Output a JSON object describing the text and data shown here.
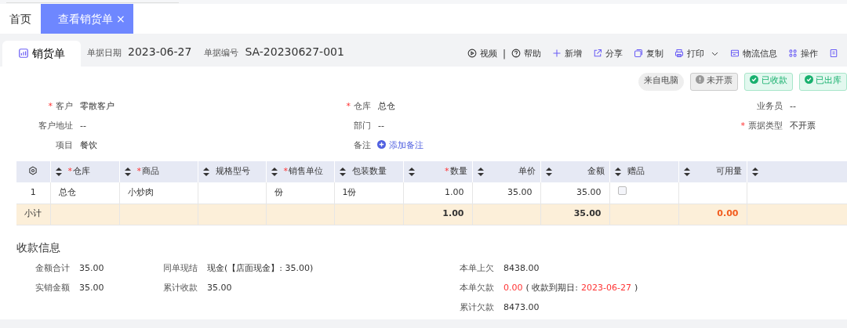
{
  "tabs": [
    {
      "label": "首页",
      "selected": false,
      "closable": false
    },
    {
      "label": "查看销货单",
      "selected": true,
      "closable": true
    }
  ],
  "close_glyph": "×",
  "doc_tab": {
    "label": "销货单",
    "selected": true
  },
  "header_fields": [
    {
      "label": "单据日期",
      "value": "2023-06-27"
    },
    {
      "label": "单据编号",
      "value": "SA-20230627-001"
    }
  ],
  "toolbar": [
    {
      "label": "视频",
      "has_menu": false
    },
    {
      "label": "帮助",
      "has_menu": false
    },
    {
      "label": "新增",
      "has_menu": false
    },
    {
      "label": "分享",
      "has_menu": false
    },
    {
      "label": "复制",
      "has_menu": false
    },
    {
      "label": "打印",
      "has_menu": true
    },
    {
      "label": "物流信息",
      "has_menu": false
    },
    {
      "label": "操作",
      "has_menu": false
    },
    {
      "has_menu": false
    }
  ],
  "toolbar_separator": "|",
  "status_tags": [
    {
      "label": "来自电脑",
      "kind": "source"
    },
    {
      "label": "未开票",
      "kind": "warning"
    },
    {
      "label": "已收款",
      "kind": "done"
    },
    {
      "label": "已出库",
      "kind": "done"
    }
  ],
  "form_rows": [
    [
      {
        "label": "客户",
        "value": "零散客户",
        "required": true,
        "kind": "text"
      },
      {
        "label": "仓库",
        "value": "总仓",
        "required": true,
        "kind": "text"
      },
      {
        "label": "业务员",
        "value": "--",
        "required": false,
        "kind": "text"
      }
    ],
    [
      {
        "label": "客户地址",
        "value": "--",
        "required": false,
        "kind": "text"
      },
      {
        "label": "部门",
        "value": "--",
        "required": false,
        "kind": "text"
      },
      {
        "label": "票据类型",
        "value": "不开票",
        "required": true,
        "kind": "text"
      }
    ],
    [
      {
        "label": "项目",
        "value": "餐饮",
        "required": false,
        "kind": "text"
      },
      {
        "label": "备注",
        "value": "添加备注",
        "required": false,
        "kind": "link"
      }
    ]
  ],
  "required_mark": "*",
  "table": {
    "columns": [
      {
        "kind": "settings"
      },
      {
        "label": "仓库",
        "kind": "text",
        "sortable": true,
        "required": true
      },
      {
        "label": "商品",
        "kind": "text",
        "sortable": true,
        "required": true
      },
      {
        "label": "规格型号",
        "kind": "text",
        "sortable": true,
        "required": false
      },
      {
        "label": "销售单位",
        "kind": "text",
        "sortable": true,
        "required": true
      },
      {
        "label": "包装数量",
        "kind": "text",
        "sortable": true,
        "required": false
      },
      {
        "label": "数量",
        "kind": "number",
        "sortable": true,
        "required": true
      },
      {
        "label": "单价",
        "kind": "number",
        "sortable": true,
        "required": false
      },
      {
        "label": "金额",
        "kind": "number",
        "sortable": true,
        "required": false
      },
      {
        "label": "赠品",
        "kind": "check",
        "sortable": true,
        "required": false
      },
      {
        "label": "可用量",
        "kind": "number",
        "sortable": true,
        "required": false
      },
      {
        "kind": "text",
        "sortable": true,
        "required": false
      }
    ],
    "rows": [
      {
        "cells": [
          "1",
          "总仓",
          "小炒肉",
          "",
          "份",
          "1份",
          "1.00",
          "35.00",
          "35.00",
          false,
          "",
          ""
        ]
      }
    ],
    "subtotal": {
      "cells": [
        {
          "text": "小计",
          "highlight": false
        },
        null,
        null,
        null,
        null,
        null,
        {
          "text": "1.00",
          "highlight": false
        },
        null,
        {
          "text": "35.00",
          "highlight": false
        },
        null,
        {
          "text": "0.00",
          "highlight": true
        },
        null
      ]
    }
  },
  "payment": {
    "title": "收款信息",
    "columns": [
      [
        {
          "label": "金额合计",
          "parts": [
            {
              "text": "35.00",
              "highlight": false
            }
          ]
        },
        {
          "label": "实销金额",
          "parts": [
            {
              "text": "35.00",
              "highlight": false
            }
          ]
        }
      ],
      [
        {
          "label": "同单现结",
          "parts": [
            {
              "text": "现金(【店面现金】: 35.00)",
              "highlight": false
            }
          ]
        },
        {
          "label": "累计收款",
          "parts": [
            {
              "text": "35.00",
              "highlight": false
            }
          ]
        }
      ],
      [
        {
          "label": "本单上欠",
          "parts": [
            {
              "text": "8438.00",
              "highlight": false
            }
          ]
        },
        {
          "label": "本单欠款",
          "parts": [
            {
              "text": "0.00",
              "highlight": true
            },
            {
              "text": "( 收款到期日:",
              "highlight": false
            },
            {
              "text": "2023-06-27",
              "highlight": true
            },
            {
              "text": ")",
              "highlight": false
            }
          ]
        },
        {
          "label": "累计欠款",
          "parts": [
            {
              "text": "8473.00",
              "highlight": false
            }
          ]
        }
      ]
    ]
  }
}
